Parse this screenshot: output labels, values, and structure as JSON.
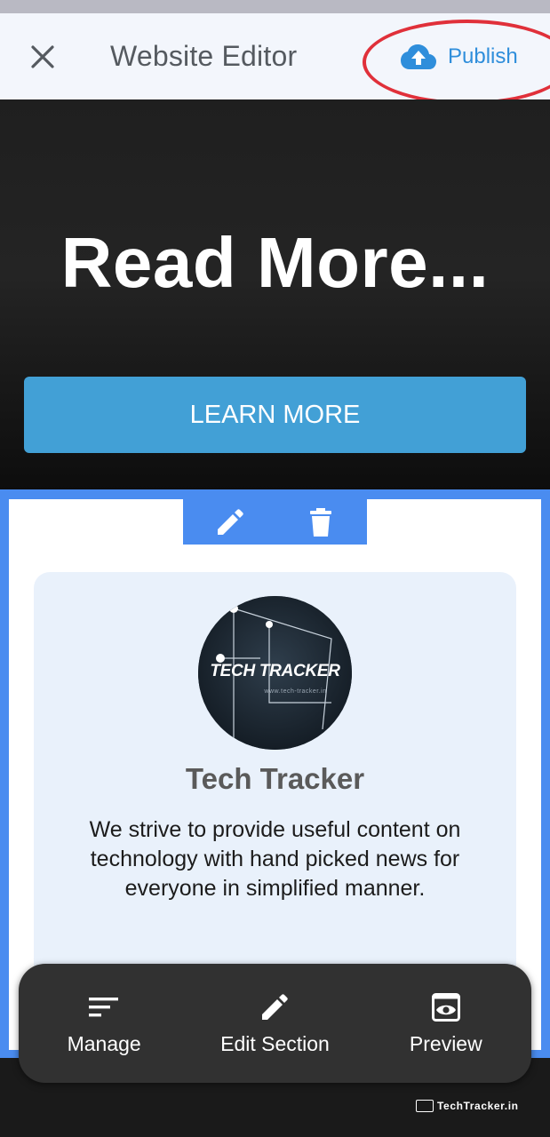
{
  "header": {
    "title": "Website Editor",
    "close_icon": "close-icon",
    "publish_label": "Publish",
    "publish_icon": "cloud-upload-icon",
    "publish_highlight_color": "#e0303a",
    "accent_color": "#2f8edb"
  },
  "hero": {
    "title": "Read More...",
    "button_label": "LEARN MORE",
    "button_color": "#42a0d6"
  },
  "section": {
    "frame_color": "#4a8cf0",
    "tools": [
      {
        "icon": "pencil-icon"
      },
      {
        "icon": "trash-icon"
      }
    ],
    "card": {
      "logo_text": "TECH TRACKER",
      "logo_subtext": "www.tech-tracker.in",
      "title": "Tech Tracker",
      "description": "We strive to provide useful content on technology with hand picked news for everyone in simplified manner."
    }
  },
  "bottom_nav": {
    "items": [
      {
        "label": "Manage",
        "icon": "sort-icon"
      },
      {
        "label": "Edit Section",
        "icon": "pencil-icon"
      },
      {
        "label": "Preview",
        "icon": "preview-eye-icon"
      }
    ]
  },
  "watermark": {
    "text": "TechTracker.in"
  }
}
